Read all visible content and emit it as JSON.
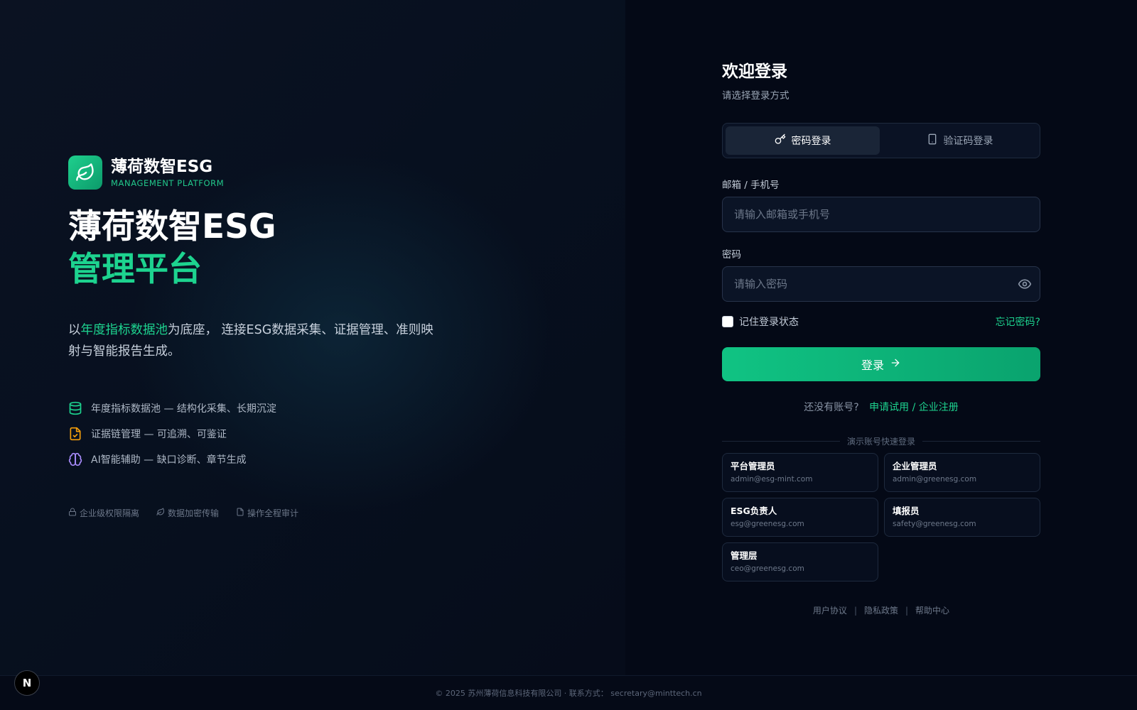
{
  "brand": {
    "name": "薄荷数智ESG",
    "sub": "MANAGEMENT PLATFORM"
  },
  "hero": {
    "title_line1": "薄荷数智ESG",
    "title_line2": "管理平台",
    "desc_prefix": "以",
    "desc_highlight": "年度指标数据池",
    "desc_suffix": "为底座， 连接ESG数据采集、证据管理、准则映射与智能报告生成。"
  },
  "features": [
    {
      "icon": "database-icon",
      "text": "年度指标数据池 — 结构化采集、长期沉淀"
    },
    {
      "icon": "file-check-icon",
      "text": "证据链管理 — 可追溯、可鉴证"
    },
    {
      "icon": "brain-icon",
      "text": "AI智能辅助 — 缺口诊断、章节生成"
    }
  ],
  "badges": [
    {
      "icon": "lock-icon",
      "text": "企业级权限隔离"
    },
    {
      "icon": "leaf-icon",
      "text": "数据加密传输"
    },
    {
      "icon": "file-icon",
      "text": "操作全程审计"
    }
  ],
  "login": {
    "title": "欢迎登录",
    "subtitle": "请选择登录方式",
    "tabs": [
      {
        "label": "密码登录",
        "icon": "key-icon",
        "active": true
      },
      {
        "label": "验证码登录",
        "icon": "phone-icon",
        "active": false
      }
    ],
    "account_label": "邮箱 / 手机号",
    "account_placeholder": "请输入邮箱或手机号",
    "password_label": "密码",
    "password_placeholder": "请输入密码",
    "remember_label": "记住登录状态",
    "forgot_label": "忘记密码?",
    "submit_label": "登录",
    "signup_question": "还没有账号?",
    "signup_link": "申请试用 / 企业注册",
    "demo_divider": "演示账号快速登录",
    "demo_accounts": [
      {
        "role": "平台管理员",
        "email": "admin@esg-mint.com"
      },
      {
        "role": "企业管理员",
        "email": "admin@greenesg.com"
      },
      {
        "role": "ESG负责人",
        "email": "esg@greenesg.com"
      },
      {
        "role": "填报员",
        "email": "safety@greenesg.com"
      },
      {
        "role": "管理层",
        "email": "ceo@greenesg.com"
      }
    ],
    "legal": [
      "用户协议",
      "隐私政策",
      "帮助中心"
    ],
    "legal_sep": "|"
  },
  "footer": {
    "text": "© 2025 苏州薄荷信息科技有限公司 · 联系方式： secretary@minttech.cn"
  },
  "next_badge": "N",
  "colors": {
    "accent": "#1dd38f",
    "background": "#050a17",
    "feature_database": "#1dd38f",
    "feature_file": "#f59e0b",
    "feature_brain": "#a78bfa"
  }
}
